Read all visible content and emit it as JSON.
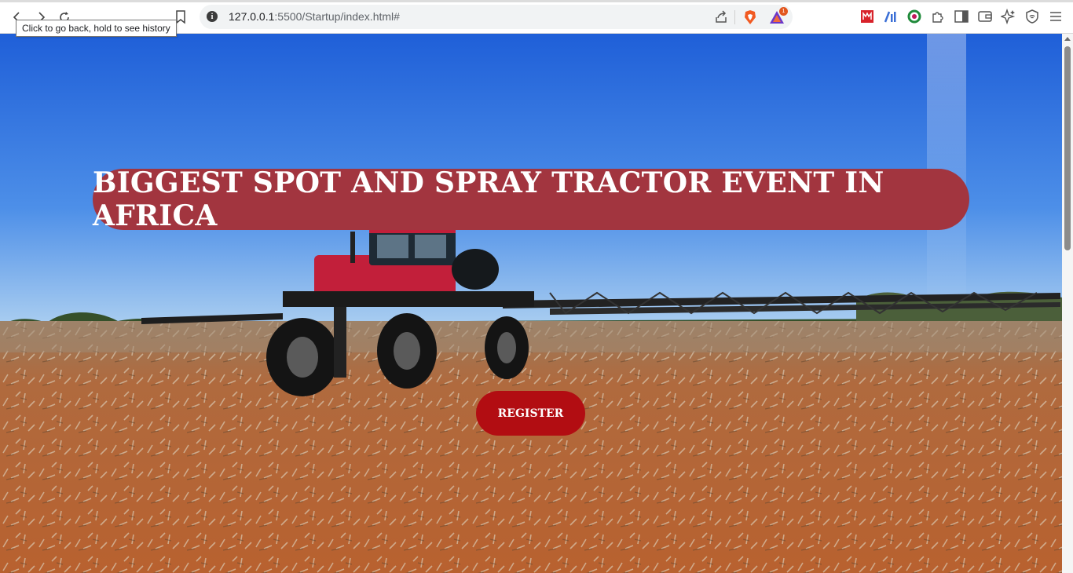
{
  "browser": {
    "url_host": "127.0.0.1",
    "url_rest": ":5500/Startup/index.html#",
    "tooltip": "Click to go back, hold to see history",
    "rewards_badge": "1"
  },
  "hero": {
    "headline": "BIGGEST SPOT AND SPRAY TRACTOR EVENT IN AFRICA",
    "register_label": "REGISTER"
  },
  "colors": {
    "headline_bg": "#a2353f",
    "register_bg": "#b20d12"
  }
}
